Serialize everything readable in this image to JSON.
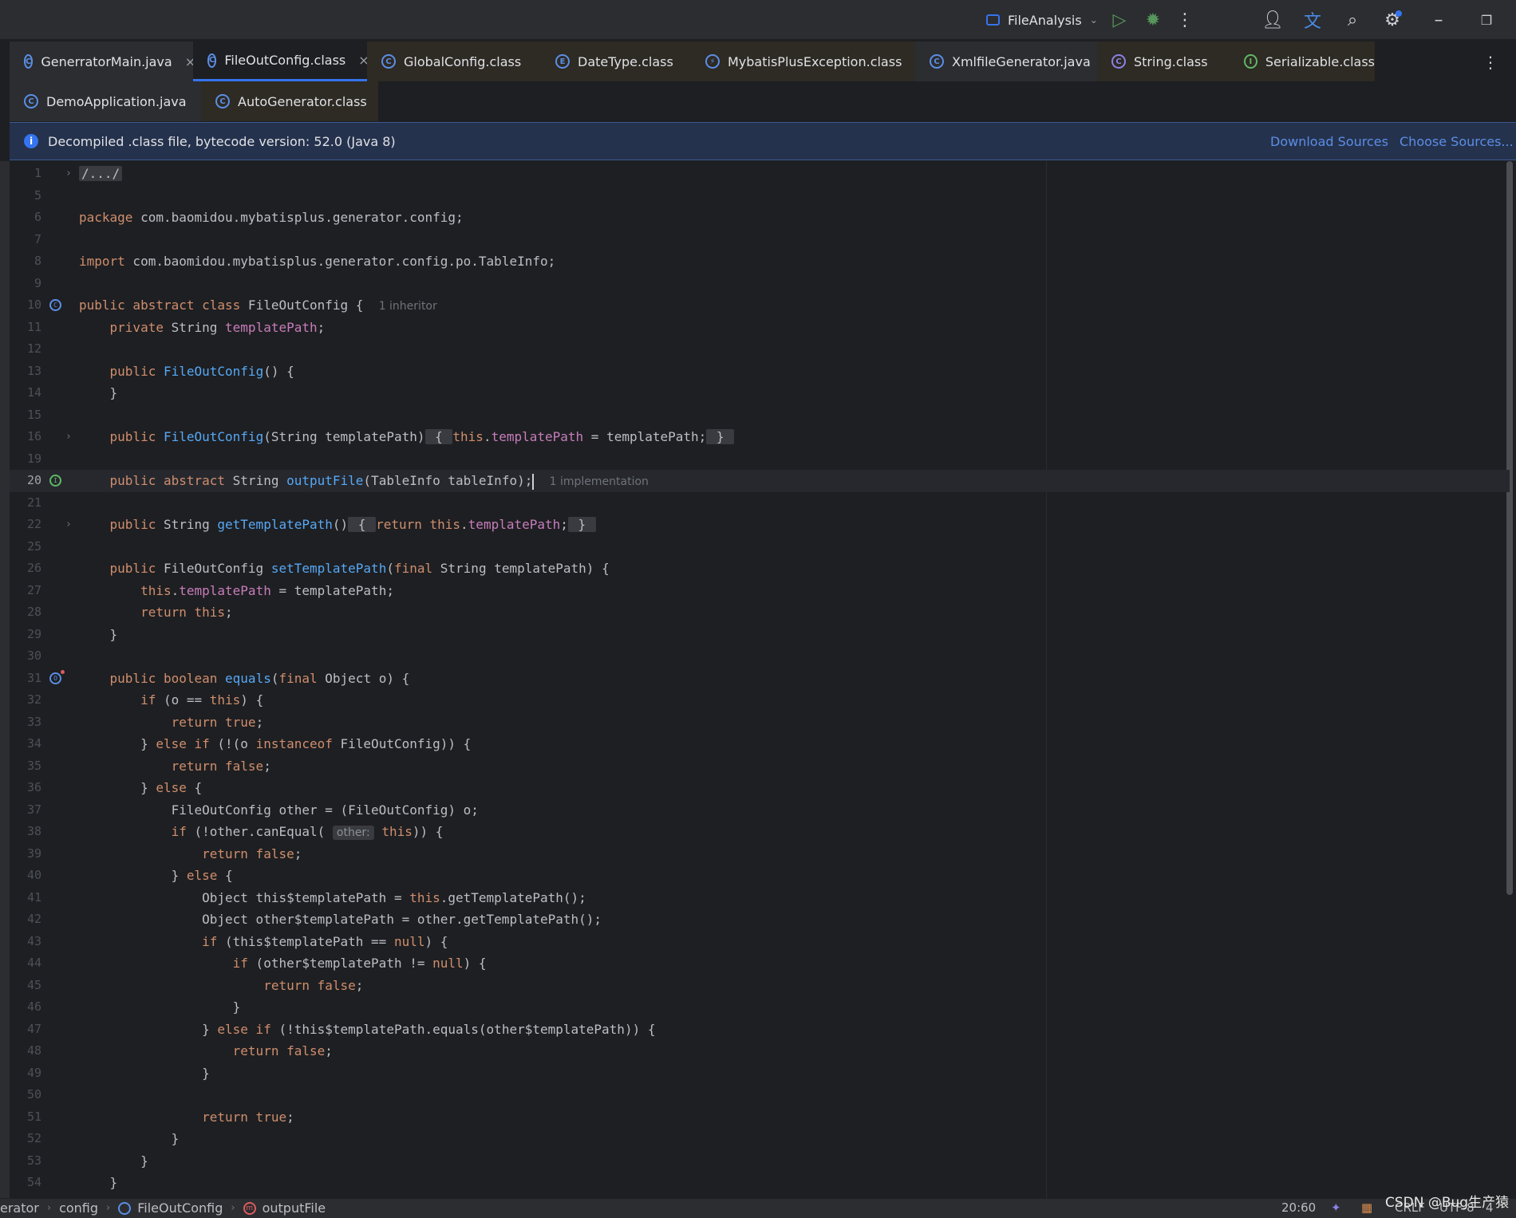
{
  "window": {
    "run_config": "FileAnalysis",
    "icons": [
      "run-icon",
      "debug-icon",
      "more-icon",
      "add-user-icon",
      "translate-icon",
      "search-icon",
      "settings-icon",
      "minimize-icon",
      "restore-icon"
    ]
  },
  "tabs_row1": [
    {
      "label": "GenerratorMain.java",
      "type": "java",
      "closable": true
    },
    {
      "label": "FileOutConfig.class",
      "type": "class",
      "closable": true,
      "active": true
    },
    {
      "label": "GlobalConfig.class",
      "type": "class"
    },
    {
      "label": "DateType.class",
      "type": "enum"
    },
    {
      "label": "MybatisPlusException.class",
      "type": "exception"
    },
    {
      "label": "XmlfileGenerator.java",
      "type": "java"
    },
    {
      "label": "String.class",
      "type": "class"
    },
    {
      "label": "Serializable.class",
      "type": "interface"
    }
  ],
  "tabs_row2": [
    {
      "label": "DemoApplication.java",
      "type": "java"
    },
    {
      "label": "AutoGenerator.class",
      "type": "class"
    }
  ],
  "banner": {
    "message": "Decompiled .class file, bytecode version: 52.0 (Java 8)",
    "download_sources": "Download Sources",
    "choose_sources": "Choose Sources..."
  },
  "hints": {
    "inheritor": "1 inheritor",
    "implementation": "1 implementation",
    "param_other": "other:"
  },
  "status": {
    "breadcrumb": [
      "erator",
      "config",
      "FileOutConfig",
      "outputFile"
    ],
    "position": "20:60",
    "line_sep": "CRLF",
    "encoding": "UTF-8",
    "indent": "4 spa",
    "watermark": "CSDN @Bug生产猿"
  }
}
